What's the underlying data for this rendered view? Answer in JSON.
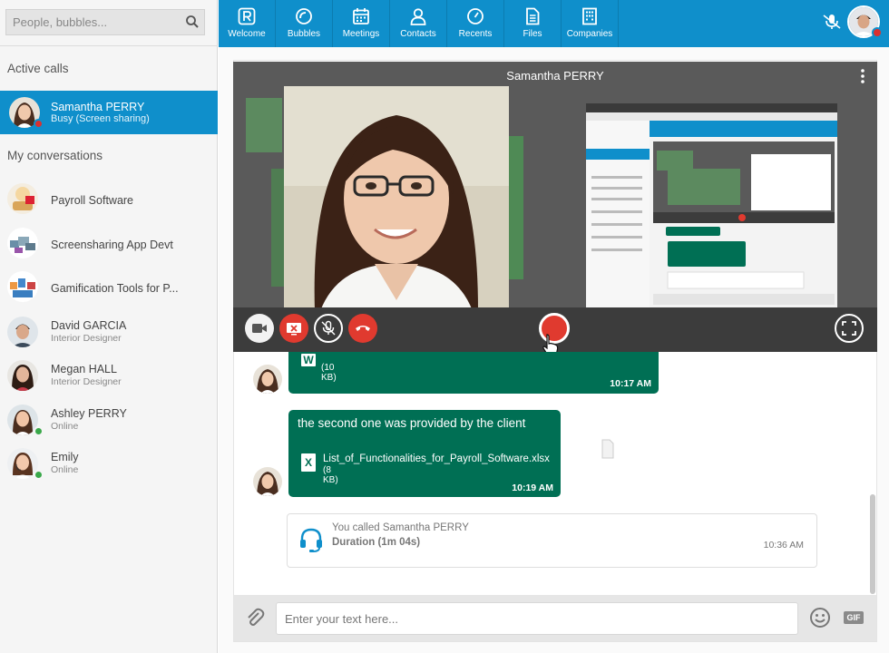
{
  "colors": {
    "brand": "#0f8fcb",
    "bubble": "#006f54",
    "busy": "#d93030",
    "online": "#3aa84a",
    "record": "#e03a2f"
  },
  "search": {
    "placeholder": "People, bubbles..."
  },
  "sidebar": {
    "active_calls_title": "Active calls",
    "active_call": {
      "name": "Samantha PERRY",
      "status": "Busy (Screen sharing)",
      "presence": "busy"
    },
    "conversations_title": "My conversations",
    "conversations": [
      {
        "name": "Payroll Software",
        "subtitle": "",
        "icon": "bubble-avatar-icon"
      },
      {
        "name": "Screensharing App Devt",
        "subtitle": "",
        "icon": "bubble-avatar-icon"
      },
      {
        "name": "Gamification Tools for P...",
        "subtitle": "",
        "icon": "bubble-avatar-icon"
      },
      {
        "name": "David GARCIA",
        "subtitle": "Interior Designer",
        "presence": ""
      },
      {
        "name": "Megan HALL",
        "subtitle": "Interior Designer",
        "presence": ""
      },
      {
        "name": "Ashley PERRY",
        "subtitle": "Online",
        "presence": "online"
      },
      {
        "name": "Emily",
        "subtitle": "Online",
        "presence": "online"
      }
    ]
  },
  "nav": {
    "items": [
      {
        "label": "Welcome",
        "icon": "rainbow-logo-icon"
      },
      {
        "label": "Bubbles",
        "icon": "bubbles-icon"
      },
      {
        "label": "Meetings",
        "icon": "calendar-icon"
      },
      {
        "label": "Contacts",
        "icon": "person-icon"
      },
      {
        "label": "Recents",
        "icon": "clock-icon"
      },
      {
        "label": "Files",
        "icon": "file-icon"
      },
      {
        "label": "Companies",
        "icon": "building-icon"
      }
    ]
  },
  "video": {
    "title": "Samantha PERRY",
    "controls": [
      "video-camera-icon",
      "stop-share-icon",
      "mute-microphone-icon",
      "hang-up-icon",
      "record-icon",
      "fullscreen-icon"
    ]
  },
  "messages": [
    {
      "text": "",
      "file_name": "",
      "file_size": "(10 KB)",
      "file_icon": "W",
      "time": "10:17 AM"
    },
    {
      "text": "the second one was provided by the client",
      "file_name": "List_of_Functionalities_for_Payroll_Software.xlsx",
      "file_size": "(8 KB)",
      "file_icon": "X",
      "time": "10:19 AM"
    }
  ],
  "call_log": {
    "line1": "You called Samantha PERRY",
    "line2": "Duration (1m 04s)",
    "time": "10:36 AM"
  },
  "composer": {
    "placeholder": "Enter your text here...",
    "gif_label": "GIF"
  }
}
